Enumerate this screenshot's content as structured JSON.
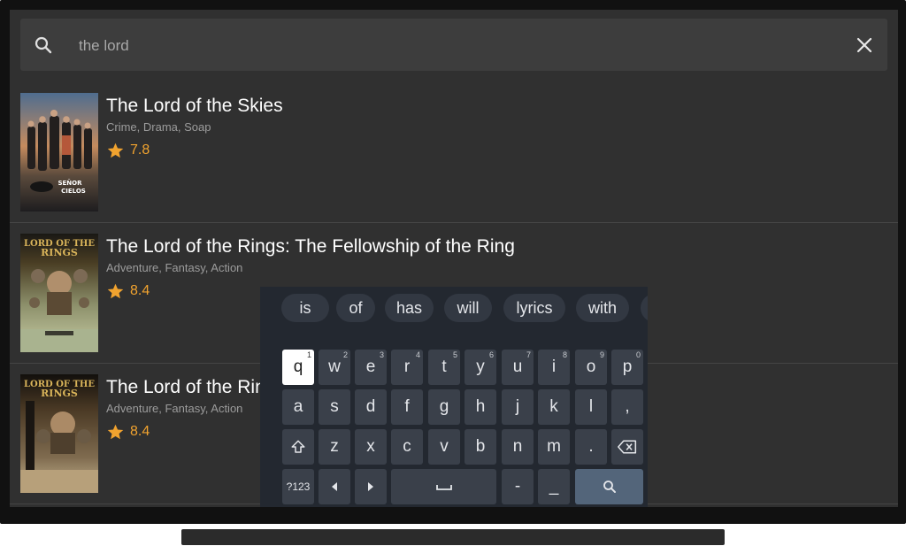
{
  "search": {
    "query": "the lord",
    "icon": "search-icon",
    "clear_icon": "close-icon"
  },
  "results": [
    {
      "title": "The Lord of the Skies",
      "genres": "Crime, Drama, Soap",
      "rating": "7.8",
      "poster_text": "el SEÑOR de los CIELOS"
    },
    {
      "title": "The Lord of the Rings: The Fellowship of the Ring",
      "genres": "Adventure, Fantasy, Action",
      "rating": "8.4",
      "poster_text": "LORD OF THE RINGS"
    },
    {
      "title": "The Lord of the Rings: The Two Towers",
      "genres": "Adventure, Fantasy, Action",
      "rating": "8.4",
      "poster_text": "LORD OF THE RINGS"
    }
  ],
  "keyboard": {
    "suggestions": [
      "is",
      "of",
      "has",
      "will",
      "lyrics",
      "with",
      "b"
    ],
    "row1": [
      {
        "label": "q",
        "hint": "1"
      },
      {
        "label": "w",
        "hint": "2"
      },
      {
        "label": "e",
        "hint": "3"
      },
      {
        "label": "r",
        "hint": "4"
      },
      {
        "label": "t",
        "hint": "5"
      },
      {
        "label": "y",
        "hint": "6"
      },
      {
        "label": "u",
        "hint": "7"
      },
      {
        "label": "i",
        "hint": "8"
      },
      {
        "label": "o",
        "hint": "9"
      },
      {
        "label": "p",
        "hint": "0"
      }
    ],
    "row2": [
      "a",
      "s",
      "d",
      "f",
      "g",
      "h",
      "j",
      "k",
      "l",
      ","
    ],
    "row3": [
      "z",
      "x",
      "c",
      "v",
      "b",
      "n",
      "m",
      "."
    ],
    "symbols_label": "?123",
    "period_key": "-",
    "underscore_key": "_",
    "focused_key": "q",
    "colors": {
      "keyboard_bg": "#232830",
      "key_bg": "#3a404a",
      "accent_search": "#53657a",
      "rating_star": "#f1a32f"
    }
  }
}
